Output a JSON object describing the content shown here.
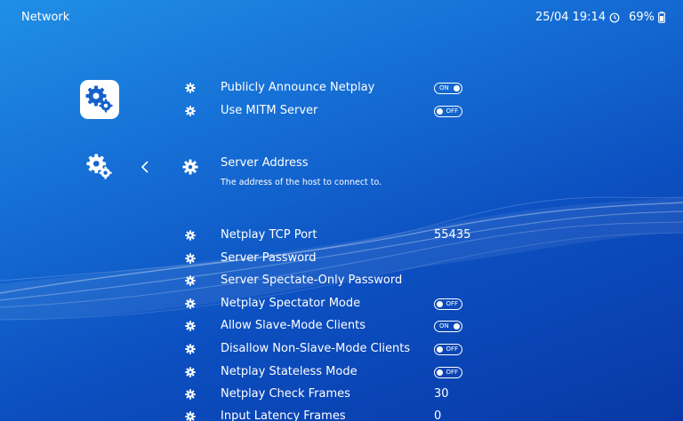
{
  "header": {
    "title": "Network",
    "datetime": "25/04 19:14",
    "battery": "69%"
  },
  "sidebar": {
    "top_icon": "settings-gears-icon",
    "current_icon": "settings-gears-icon",
    "back_icon": "chevron-left-icon"
  },
  "menu": {
    "items": [
      {
        "label": "Publicly Announce Netplay",
        "toggle": "ON"
      },
      {
        "label": "Use MITM Server",
        "toggle": "OFF"
      },
      {
        "label": "Server Address",
        "description": "The address of the host to connect to."
      },
      {
        "label": "Netplay TCP Port",
        "value": "55435"
      },
      {
        "label": "Server Password"
      },
      {
        "label": "Server Spectate-Only Password"
      },
      {
        "label": "Netplay Spectator Mode",
        "toggle": "OFF"
      },
      {
        "label": "Allow Slave-Mode Clients",
        "toggle": "ON"
      },
      {
        "label": "Disallow Non-Slave-Mode Clients",
        "toggle": "OFF"
      },
      {
        "label": "Netplay Stateless Mode",
        "toggle": "OFF"
      },
      {
        "label": "Netplay Check Frames",
        "value": "30"
      },
      {
        "label": "Input Latency Frames",
        "value": "0"
      }
    ]
  },
  "colors": {
    "background_top": "#1f8fe6",
    "background_bottom": "#0838a6",
    "text": "#ffffff"
  }
}
